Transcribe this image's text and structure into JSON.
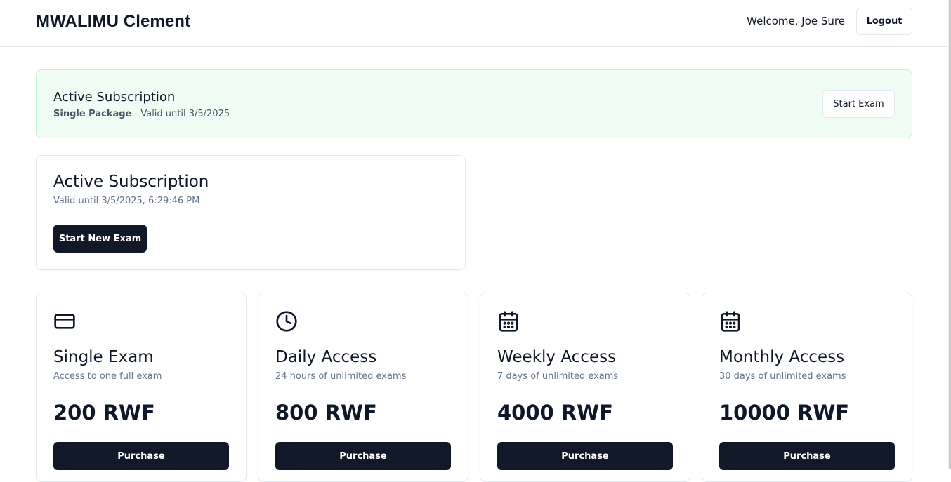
{
  "header": {
    "brand": "MWALIMU Clement",
    "welcome": "Welcome, Joe Sure",
    "logout_label": "Logout"
  },
  "banner": {
    "title": "Active Subscription",
    "package": "Single Package",
    "validity": " - Valid until 3/5/2025",
    "button_label": "Start Exam"
  },
  "subscription_card": {
    "title": "Active Subscription",
    "valid_until": "Valid until 3/5/2025, 6:29:46 PM",
    "button_label": "Start New Exam"
  },
  "plans": [
    {
      "icon": "credit-card-icon",
      "name": "Single Exam",
      "description": "Access to one full exam",
      "price": "200 RWF",
      "button_label": "Purchase"
    },
    {
      "icon": "clock-icon",
      "name": "Daily Access",
      "description": "24 hours of unlimited exams",
      "price": "800 RWF",
      "button_label": "Purchase"
    },
    {
      "icon": "calendar-icon",
      "name": "Weekly Access",
      "description": "7 days of unlimited exams",
      "price": "4000 RWF",
      "button_label": "Purchase"
    },
    {
      "icon": "calendar-icon",
      "name": "Monthly Access",
      "description": "30 days of unlimited exams",
      "price": "10000 RWF",
      "button_label": "Purchase"
    }
  ],
  "colors": {
    "primary_dark": "#111827",
    "banner_bg": "#f0fdf4",
    "banner_border": "#bbf7d0",
    "muted_text": "#64748b"
  }
}
